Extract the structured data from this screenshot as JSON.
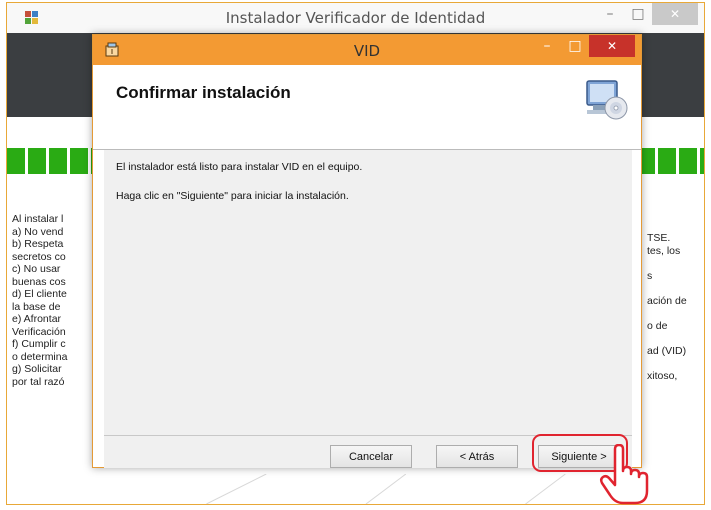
{
  "outer_window": {
    "title": "Instalador Verificador de Identidad",
    "minimize": "–",
    "maximize": "□",
    "close": "✕",
    "left_text_lines": [
      "Al instalar l",
      "a) No vend",
      "b) Respeta",
      "secretos co",
      "c) No usar",
      "buenas cos",
      "d) El cliente",
      "la base de",
      "e) Afrontar",
      "Verificación",
      "f) Cumplir c",
      "o determina",
      "g) Solicitar",
      "por tal razó"
    ],
    "right_text_lines": [
      "TSE.",
      "tes, los",
      "",
      "s",
      "",
      "ación de",
      "",
      "o de",
      "",
      "ad (VID)",
      "",
      "xitoso,"
    ]
  },
  "dialog": {
    "title": "VID",
    "minimize": "–",
    "maximize": "□",
    "close": "✕",
    "heading": "Confirmar instalación",
    "message_1": "El instalador está listo para instalar VID en el equipo.",
    "message_2": "Haga clic en \"Siguiente\" para iniciar la instalación.",
    "buttons": {
      "cancel": "Cancelar",
      "back": "< Atrás",
      "next": "Siguiente >"
    }
  },
  "colors": {
    "dialog_titlebar": "#f39a33",
    "close_button": "#c7322a",
    "green_stripe": "#2aab14",
    "dark_band": "#3b3e41",
    "highlight": "#e0242f"
  },
  "icons": [
    "app-icon",
    "installer-icon",
    "computer-cd-icon",
    "hand-pointer-icon"
  ]
}
